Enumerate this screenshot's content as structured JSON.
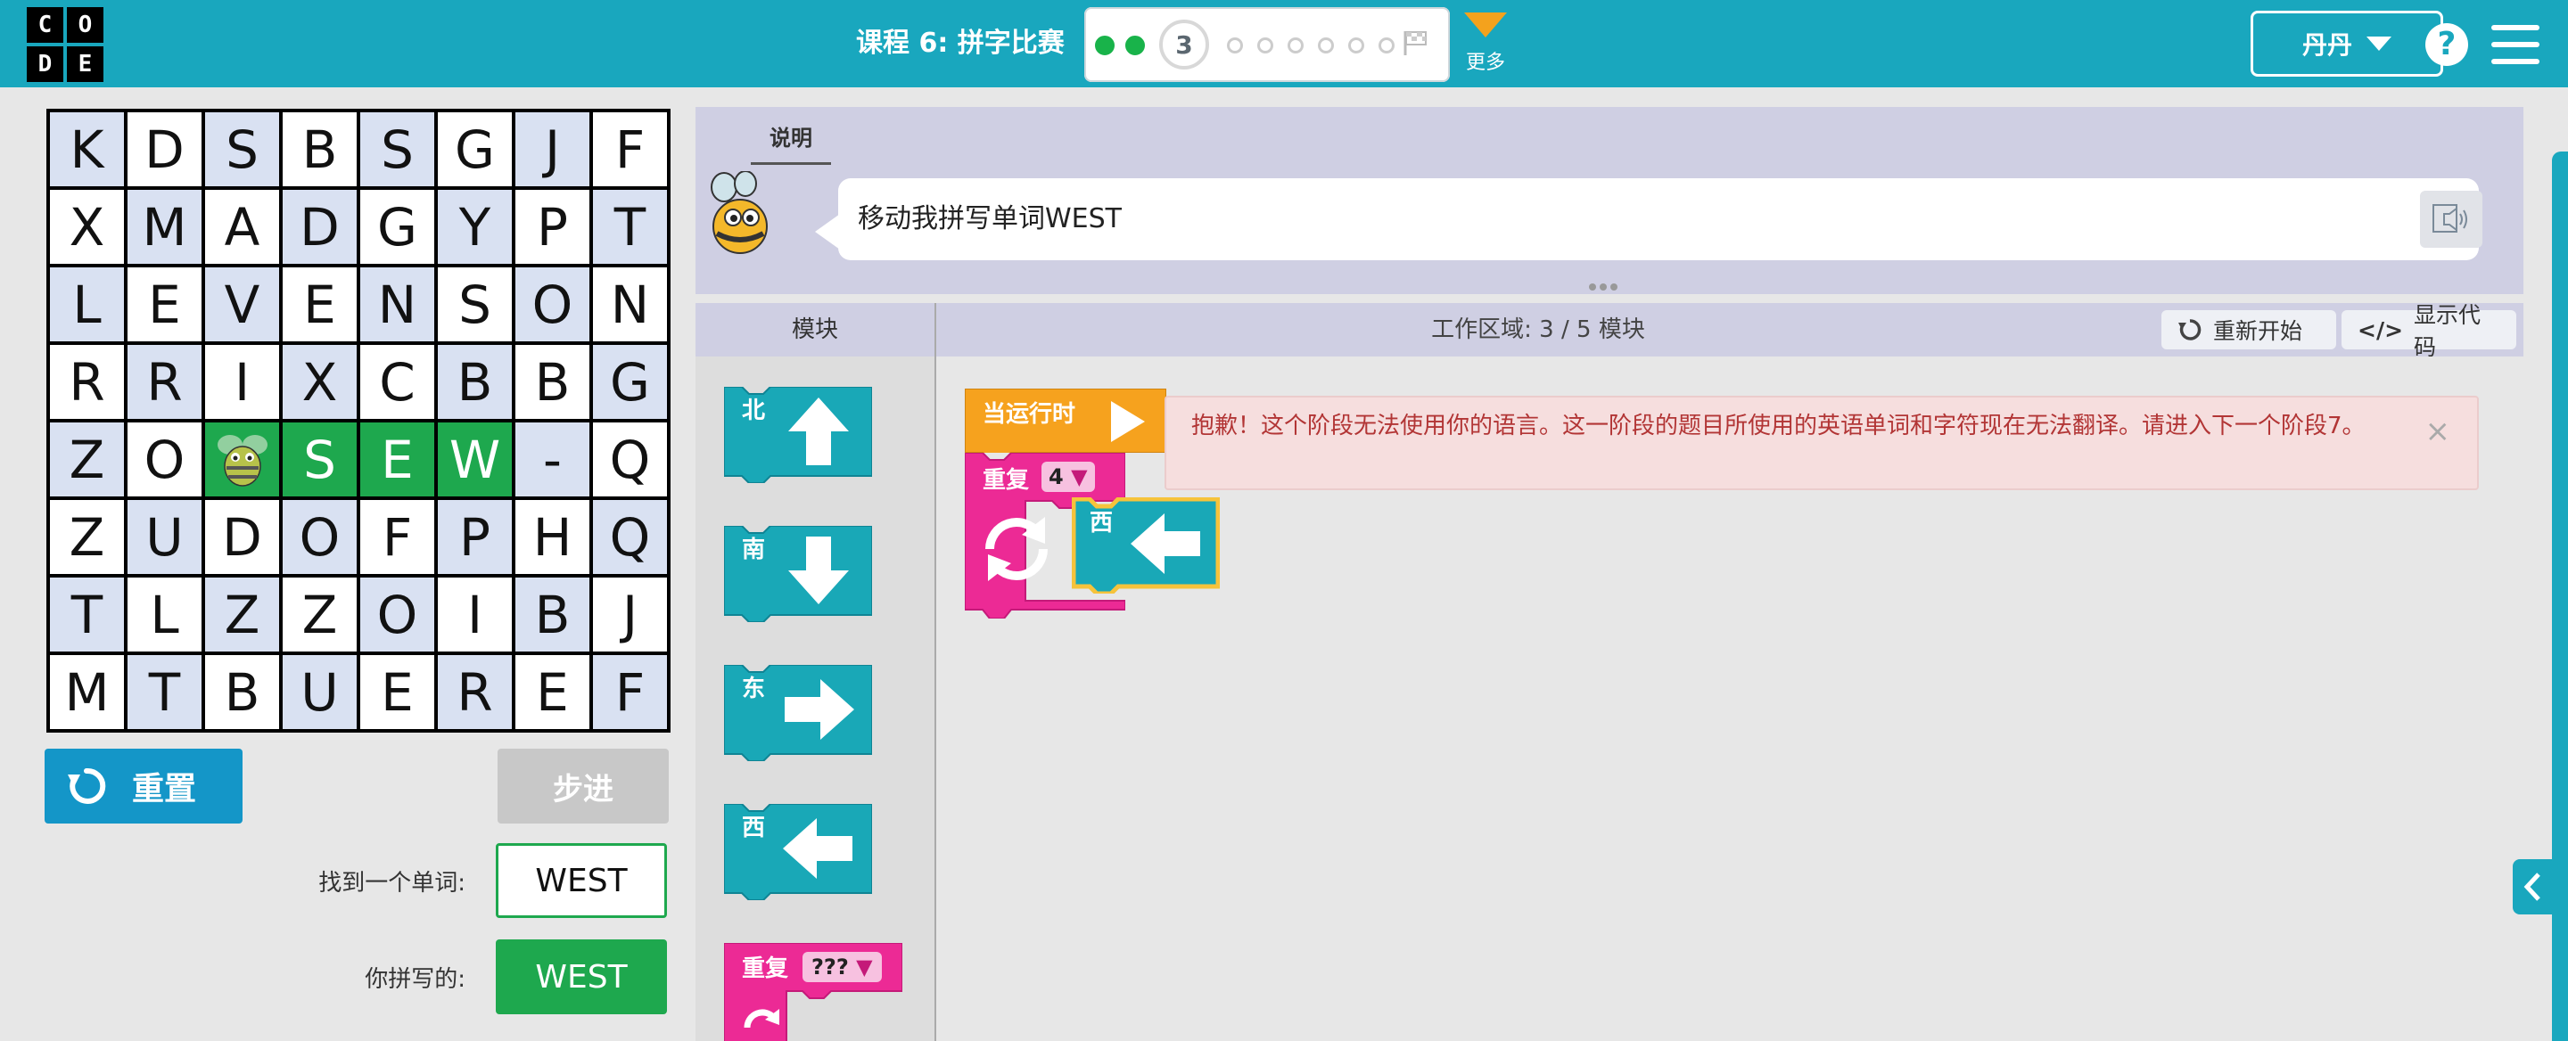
{
  "header": {
    "logo_letters": [
      "C",
      "O",
      "D",
      "E"
    ],
    "lesson_title": "课程 6: 拼字比赛",
    "progress": {
      "completed": 2,
      "current_level": "3",
      "remaining": 6
    },
    "more_label": "更多",
    "user_name": "丹丹",
    "help_label": "?",
    "brand_color": "#19a7be"
  },
  "puzzle": {
    "rows": [
      [
        "K",
        "D",
        "S",
        "B",
        "S",
        "G",
        "J",
        "F"
      ],
      [
        "X",
        "M",
        "A",
        "D",
        "G",
        "Y",
        "P",
        "T"
      ],
      [
        "L",
        "E",
        "V",
        "E",
        "N",
        "S",
        "O",
        "N"
      ],
      [
        "R",
        "R",
        "I",
        "X",
        "C",
        "B",
        "B",
        "G"
      ],
      [
        "Z",
        "O",
        "",
        "S",
        "E",
        "W",
        "-",
        "Q"
      ],
      [
        "Z",
        "U",
        "D",
        "O",
        "F",
        "P",
        "H",
        "Q"
      ],
      [
        "T",
        "L",
        "Z",
        "Z",
        "O",
        "I",
        "B",
        "J"
      ],
      [
        "M",
        "T",
        "B",
        "U",
        "E",
        "R",
        "E",
        "F"
      ]
    ],
    "highlighted": [
      [
        4,
        2
      ],
      [
        4,
        3
      ],
      [
        4,
        4
      ],
      [
        4,
        5
      ]
    ],
    "bee_cell": [
      4,
      2
    ]
  },
  "controls": {
    "reset_label": "重置",
    "step_label": "步进",
    "find_word_label": "找到一个单词:",
    "find_word_value": "WEST",
    "spelled_label": "你拼写的:",
    "spelled_value": "WEST"
  },
  "instructions": {
    "tab_label": "说明",
    "text": "移动我拼写单词WEST"
  },
  "toolbox": {
    "header": "模块",
    "blocks": [
      {
        "label": "北",
        "icon": "arrow-up-icon"
      },
      {
        "label": "南",
        "icon": "arrow-down-icon"
      },
      {
        "label": "东",
        "icon": "arrow-right-icon"
      },
      {
        "label": "西",
        "icon": "arrow-left-icon"
      }
    ],
    "repeat_label": "重复",
    "repeat_value": "???"
  },
  "workspace": {
    "title": "工作区域: 3 / 5 模块",
    "restart_label": "重新开始",
    "show_code_label": "显示代码",
    "when_run_label": "当运行时",
    "repeat_label": "重复",
    "repeat_count": "4",
    "inner_block_label": "西",
    "error_message": "抱歉！这个阶段无法使用你的语言。这一阶段的题目所使用的英语单词和字符现在无法翻译。请进入下一个阶段7。",
    "error_close": "×"
  },
  "colors": {
    "move_block": "#19a8b7",
    "repeat_block": "#ec2a95",
    "event_block": "#f6a21e",
    "success": "#1ea84e",
    "error_text": "#b23535"
  }
}
